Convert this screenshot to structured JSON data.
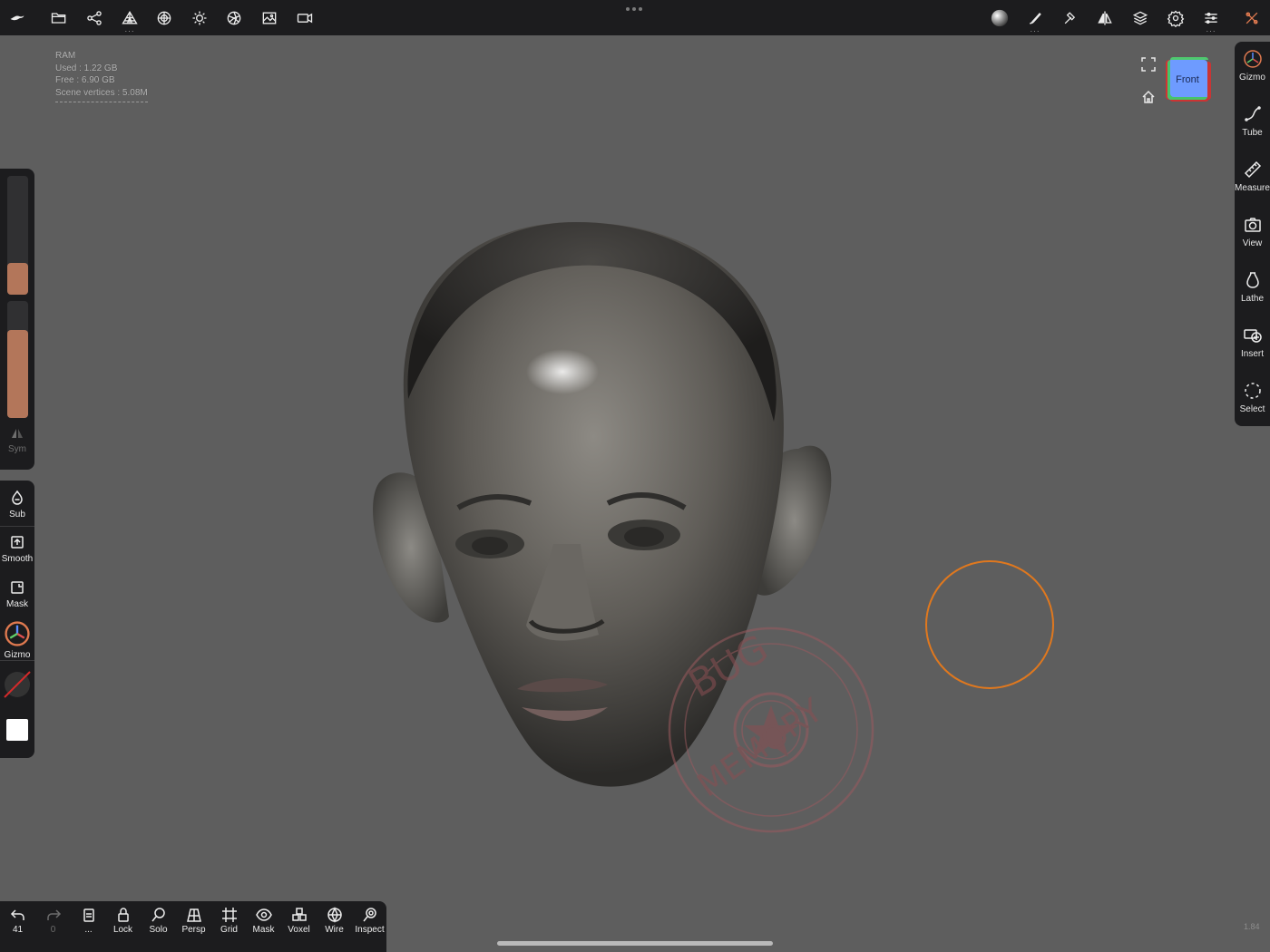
{
  "topbar": {
    "left_icons": [
      "nomad-logo-icon",
      "folder-icon",
      "scene-tree-icon",
      "topology-icon",
      "material-sphere-icon",
      "light-sun-icon",
      "shading-icon",
      "background-image-icon",
      "camera-icon"
    ],
    "right_icons": [
      "matcap-ball-icon",
      "brush-stroke-icon",
      "tool-hammer-icon",
      "symmetry-icon",
      "layers-icon",
      "settings-gear-icon",
      "sliders-icon",
      "tools-x-icon"
    ]
  },
  "stats": {
    "line1": "RAM",
    "line2": "Used : 1.22 GB",
    "line3": "Free : 6.90 GB",
    "line4": "Scene vertices : 5.08M"
  },
  "orientation_cube": {
    "label": "Front"
  },
  "right_tools": [
    {
      "label": "Gizmo"
    },
    {
      "label": "Tube"
    },
    {
      "label": "Measure"
    },
    {
      "label": "View"
    },
    {
      "label": "Lathe"
    },
    {
      "label": "Insert"
    },
    {
      "label": "Select"
    }
  ],
  "left_panel": {
    "radius_level": 0.27,
    "intensity_level": 0.75,
    "sym_label": "Sym",
    "slider_color": "#b3765a"
  },
  "left_tools": [
    {
      "label": "Sub"
    },
    {
      "label": "Smooth"
    },
    {
      "label": "Mask"
    },
    {
      "label": "Gizmo"
    }
  ],
  "bottombar": {
    "undo_count": "41",
    "redo_count": "0",
    "menu_label": "...",
    "items": [
      {
        "label": "Lock"
      },
      {
        "label": "Solo"
      },
      {
        "label": "Persp"
      },
      {
        "label": "Grid"
      },
      {
        "label": "Mask"
      },
      {
        "label": "Voxel"
      },
      {
        "label": "Wire"
      },
      {
        "label": "Inspect"
      }
    ]
  },
  "watermark": {
    "top_text": "BUG",
    "bottom_text": "MEMORY"
  },
  "version": "1.84",
  "colors": {
    "background": "#5e5e5e",
    "bar": "#1c1c1e",
    "brush_circle": "#e0781e",
    "accent": "#b3765a"
  }
}
